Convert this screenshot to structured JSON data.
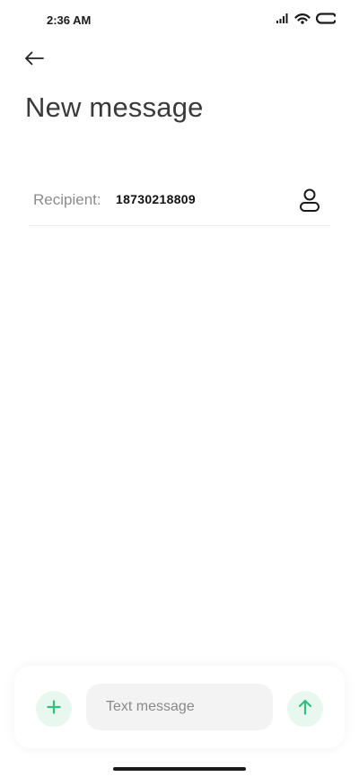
{
  "status_bar": {
    "time": "2:36 AM",
    "icons": [
      "signal-icon",
      "wifi-icon",
      "battery-icon"
    ]
  },
  "header": {
    "back_icon": "back-arrow-icon",
    "title": "New message"
  },
  "recipient": {
    "label": "Recipient:",
    "value": "18730218809",
    "contact_icon": "contact-icon"
  },
  "composer": {
    "add_icon": "plus-icon",
    "placeholder": "Text message",
    "send_icon": "send-arrow-icon"
  },
  "colors": {
    "accent": "#2ec27e",
    "accent_bg": "#e8f7ef",
    "input_bg": "#f3f3f3"
  }
}
